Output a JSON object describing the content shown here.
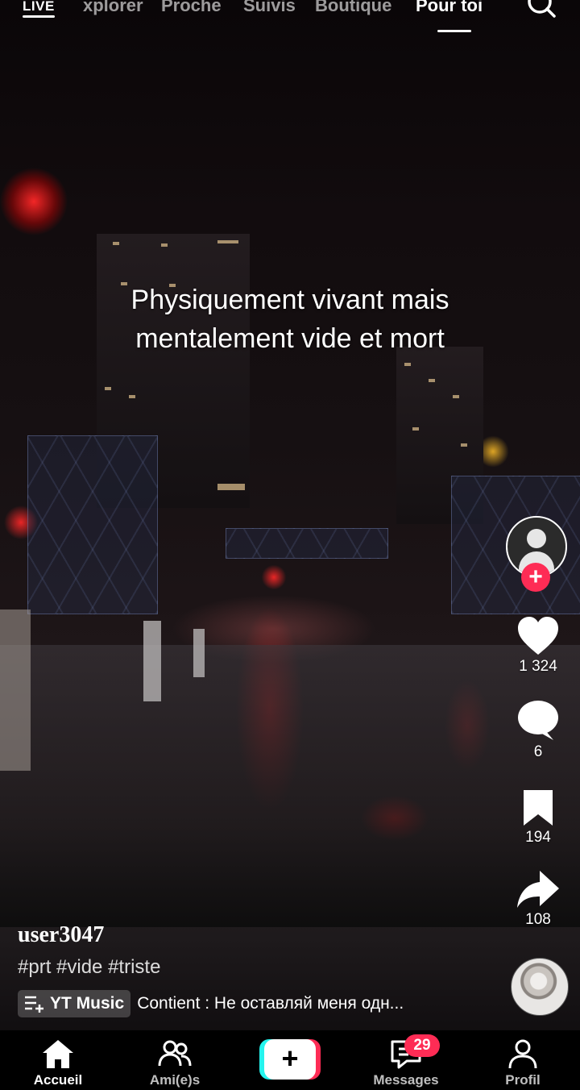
{
  "top_nav": {
    "live_label": "LIVE",
    "tabs": [
      {
        "label": "xplorer"
      },
      {
        "label": "Proche"
      },
      {
        "label": "Suivis"
      },
      {
        "label": "Boutique"
      },
      {
        "label": "Pour toi",
        "active": true
      }
    ]
  },
  "video": {
    "caption_line1": "Physiquement vivant mais",
    "caption_line2": "mentalement vide et mort",
    "username": "user3047",
    "hashtags": "#prt #vide #triste",
    "music_chip": "YT Music",
    "music_track": "Contient : Не оставляй меня одн..."
  },
  "actions": {
    "likes": "1 324",
    "comments": "6",
    "bookmarks": "194",
    "shares": "108"
  },
  "bottom_nav": {
    "home": "Accueil",
    "friends": "Ami(e)s",
    "messages": "Messages",
    "messages_badge": "29",
    "profile": "Profil"
  },
  "colors": {
    "accent": "#fe2c55",
    "cyan": "#25f4ee"
  }
}
